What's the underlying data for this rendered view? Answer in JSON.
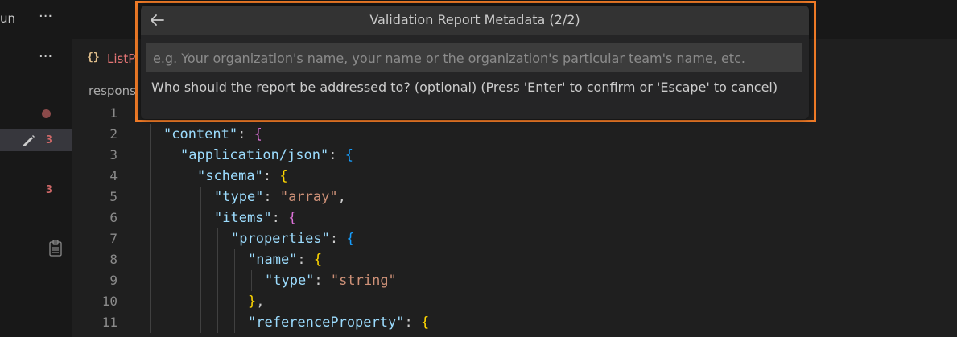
{
  "sidebar": {
    "title_partial": "un",
    "more_label": "···",
    "badges": [
      "3",
      "3"
    ]
  },
  "editor": {
    "tab": {
      "icon_text": "{}",
      "label": "ListP"
    },
    "breadcrumb": "respons",
    "lines": [
      {
        "n": "1"
      },
      {
        "n": "2",
        "key": "\"content\"",
        "after": ": ",
        "open": "{",
        "bclass": "b2"
      },
      {
        "n": "3",
        "key": "\"application/json\"",
        "after": ": ",
        "open": "{",
        "bclass": "b3"
      },
      {
        "n": "4",
        "key": "\"schema\"",
        "after": ": ",
        "open": "{",
        "bclass": "b1"
      },
      {
        "n": "5",
        "key": "\"type\"",
        "after": ": ",
        "str": "\"array\"",
        "tail": ","
      },
      {
        "n": "6",
        "key": "\"items\"",
        "after": ": ",
        "open": "{",
        "bclass": "b2"
      },
      {
        "n": "7",
        "key": "\"properties\"",
        "after": ": ",
        "open": "{",
        "bclass": "b3"
      },
      {
        "n": "8",
        "key": "\"name\"",
        "after": ": ",
        "open": "{",
        "bclass": "b1"
      },
      {
        "n": "9",
        "key": "\"type\"",
        "after": ": ",
        "str": "\"string\""
      },
      {
        "n": "10",
        "close": "}",
        "bclass": "b1",
        "tail": ","
      },
      {
        "n": "11",
        "key": "\"referenceProperty\"",
        "after": ": ",
        "open": "{",
        "bclass": "b1"
      }
    ]
  },
  "quick_input": {
    "title": "Validation Report Metadata (2/2)",
    "back_icon": "arrow-left-icon",
    "placeholder": "e.g. Your organization's name, your name or the organization's particular team's name, etc.",
    "value": "",
    "message": "Who should the report be addressed to? (optional) (Press 'Enter' to confirm or 'Escape' to cancel)"
  },
  "colors": {
    "highlight_outline": "#f07b27",
    "json_key": "#9cdcfe",
    "json_string": "#ce9178"
  }
}
